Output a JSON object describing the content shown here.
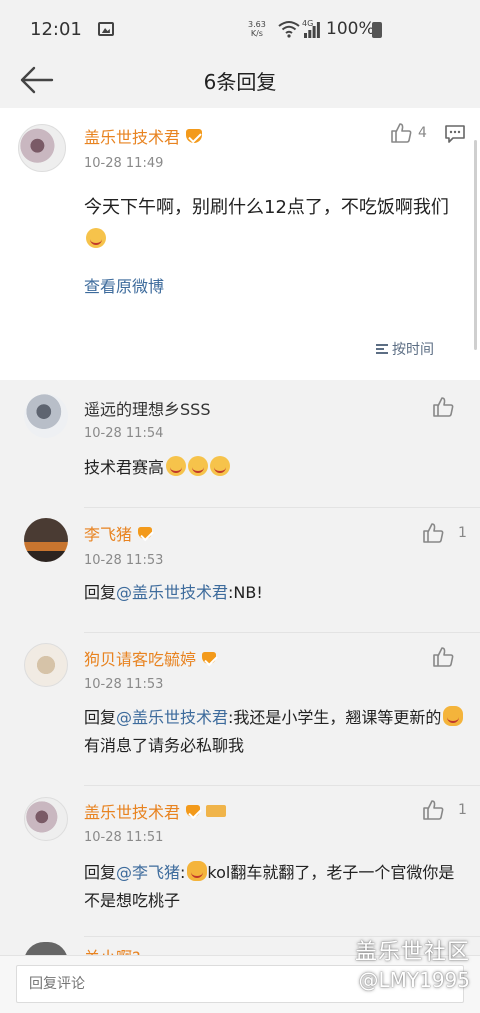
{
  "status": {
    "time": "12:01",
    "speed_top": "3.63",
    "speed_bottom": "K/s",
    "network": "4G",
    "battery": "100%"
  },
  "header": {
    "title": "6条回复"
  },
  "main_post": {
    "name": "盖乐世技术君",
    "time": "10-28 11:49",
    "likes": "4",
    "text": "今天下午啊，别刷什么12点了，不吃饭啊我们",
    "view_origin": "查看原微博",
    "sort": "按时间"
  },
  "replies": [
    {
      "name": "遥远的理想乡SSS",
      "time": "10-28 11:54",
      "likes": "",
      "text": "技术君赛高"
    },
    {
      "name": "李飞猪",
      "time": "10-28 11:53",
      "likes": "1",
      "prefix": "回复",
      "mention": "@盖乐世技术君",
      "text": ":NB!"
    },
    {
      "name": "狗贝请客吃毓婷",
      "time": "10-28 11:53",
      "likes": "",
      "prefix": "回复",
      "mention": "@盖乐世技术君",
      "text": ":我还是小学生，翘课等更新的",
      "text2": "有消息了请务必私聊我"
    },
    {
      "name": "盖乐世技术君",
      "time": "10-28 11:51",
      "likes": "1",
      "prefix": "回复",
      "mention": "@李飞猪",
      "text": ":",
      "text2": "kol翻车就翻了，老子一个官微你是不是想吃桃子"
    }
  ],
  "partial_name": "关小啊?",
  "input": {
    "placeholder": "回复评论"
  },
  "watermark": {
    "line1": "盖乐世社区",
    "line2": "@LMY1995"
  },
  "colors": {
    "accent_name": "#e88320",
    "link": "#3d6b9c"
  }
}
